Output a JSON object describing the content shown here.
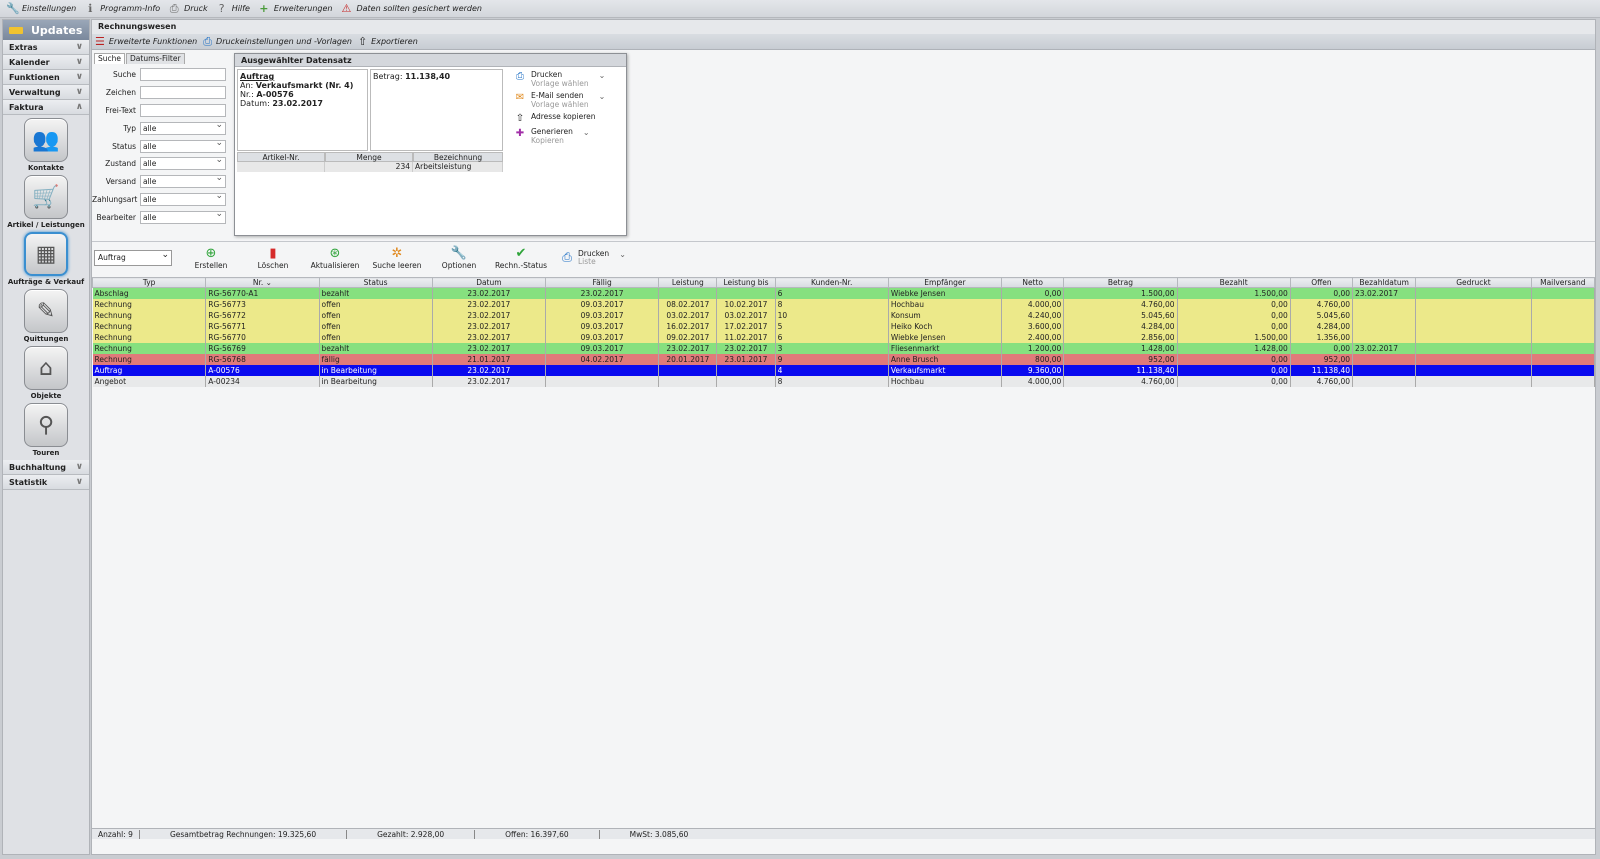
{
  "topbar": [
    {
      "label": "Einstellungen",
      "icon": "wrench-icon"
    },
    {
      "label": "Programm-Info",
      "icon": "info-icon"
    },
    {
      "label": "Druck",
      "icon": "printer-icon"
    },
    {
      "label": "Hilfe",
      "icon": "help-icon"
    },
    {
      "label": "Erweiterungen",
      "icon": "plus-icon"
    },
    {
      "label": "Daten sollten gesichert werden",
      "icon": "warning-icon"
    }
  ],
  "sidebar": {
    "title": "Updates",
    "sections_top": [
      "Extras",
      "Kalender",
      "Funktionen",
      "Verwaltung",
      "Faktura"
    ],
    "tiles": [
      {
        "label": "Kontakte",
        "icon": "contacts-icon"
      },
      {
        "label": "Artikel / Leistungen",
        "icon": "cart-icon"
      },
      {
        "label": "Aufträge & Verkauf",
        "icon": "calculator-icon"
      },
      {
        "label": "Quittungen",
        "icon": "pen-icon"
      },
      {
        "label": "Objekte",
        "icon": "house-icon"
      },
      {
        "label": "Touren",
        "icon": "map-pin-icon"
      }
    ],
    "sections_bottom": [
      "Buchhaltung",
      "Statistik"
    ]
  },
  "main": {
    "title": "Rechnungswesen",
    "toolbar": [
      "Erweiterte Funktionen",
      "Druckeinstellungen und -Vorlagen",
      "Exportieren"
    ]
  },
  "search": {
    "tabs": [
      "Suche",
      "Datums-Filter"
    ],
    "fields": [
      {
        "label": "Suche",
        "value": ""
      },
      {
        "label": "Zeichen",
        "value": ""
      },
      {
        "label": "Frei-Text",
        "value": ""
      }
    ],
    "selects": [
      {
        "label": "Typ",
        "value": "alle"
      },
      {
        "label": "Status",
        "value": "alle"
      },
      {
        "label": "Zustand",
        "value": "alle"
      },
      {
        "label": "Versand",
        "value": "alle"
      },
      {
        "label": "Zahlungsart",
        "value": "alle"
      },
      {
        "label": "Bearbeiter",
        "value": "alle"
      }
    ]
  },
  "detail": {
    "title": "Ausgewählter Datensatz",
    "doc_type": "Auftrag",
    "an_label": "An:",
    "an_value": "Verkaufsmarkt (Nr. 4)",
    "nr_label": "Nr.:",
    "nr_value": "A-00576",
    "datum_label": "Datum:",
    "datum_value": "23.02.2017",
    "betrag_label": "Betrag:",
    "betrag_value": "11.138,40",
    "table_headers": [
      "Artikel-Nr.",
      "Menge",
      "Bezeichnung"
    ],
    "table_rows": [
      [
        "",
        "234",
        "Arbeitsleistung"
      ]
    ],
    "actions": [
      {
        "label": "Drucken",
        "sub": "Vorlage wählen",
        "icon": "printer-icon",
        "dropdown": true
      },
      {
        "label": "E-Mail senden",
        "sub": "Vorlage wählen",
        "icon": "mail-icon",
        "dropdown": true
      },
      {
        "label": "Adresse kopieren",
        "sub": "",
        "icon": "upload-icon",
        "dropdown": false
      },
      {
        "label": "Generieren",
        "sub": "Kopieren",
        "icon": "puzzle-icon",
        "dropdown": true
      }
    ]
  },
  "listbar": {
    "combo": "Auftrag",
    "buttons": [
      {
        "label": "Erstellen",
        "icon": "add-icon",
        "color": "#2fa43a"
      },
      {
        "label": "Löschen",
        "icon": "trash-icon",
        "color": "#d62b2b"
      },
      {
        "label": "Aktualisieren",
        "icon": "refresh-icon",
        "color": "#2fa43a"
      },
      {
        "label": "Suche leeren",
        "icon": "clear-search-icon",
        "color": "#e0891f"
      },
      {
        "label": "Optionen",
        "icon": "wrench-icon",
        "color": "#666666"
      },
      {
        "label": "Rechn.-Status",
        "icon": "check-icon",
        "color": "#2fa43a"
      }
    ],
    "print": {
      "label": "Drucken",
      "sub": "Liste"
    }
  },
  "grid": {
    "headers": [
      "Typ",
      "Nr. ⌄",
      "Status",
      "Datum",
      "Fällig",
      "Leistung",
      "Leistung bis",
      "Kunden-Nr.",
      "Empfänger",
      "Netto",
      "Betrag",
      "Bezahlt",
      "Offen",
      "Bezahldatum",
      "Gedruckt",
      "Mailversand"
    ],
    "rows": [
      {
        "style": "green",
        "cells": [
          "Abschlag",
          "RG-56770-A1",
          "bezahlt",
          "23.02.2017",
          "23.02.2017",
          "",
          "",
          "6",
          "Wiebke Jensen",
          "0,00",
          "1.500,00",
          "1.500,00",
          "0,00",
          "23.02.2017",
          "",
          ""
        ]
      },
      {
        "style": "yellow",
        "cells": [
          "Rechnung",
          "RG-56773",
          "offen",
          "23.02.2017",
          "09.03.2017",
          "08.02.2017",
          "10.02.2017",
          "8",
          "Hochbau",
          "4.000,00",
          "4.760,00",
          "0,00",
          "4.760,00",
          "",
          "",
          ""
        ]
      },
      {
        "style": "yellow",
        "cells": [
          "Rechnung",
          "RG-56772",
          "offen",
          "23.02.2017",
          "09.03.2017",
          "03.02.2017",
          "03.02.2017",
          "10",
          "Konsum",
          "4.240,00",
          "5.045,60",
          "0,00",
          "5.045,60",
          "",
          "",
          ""
        ]
      },
      {
        "style": "yellow",
        "cells": [
          "Rechnung",
          "RG-56771",
          "offen",
          "23.02.2017",
          "09.03.2017",
          "16.02.2017",
          "17.02.2017",
          "5",
          "Heiko Koch",
          "3.600,00",
          "4.284,00",
          "0,00",
          "4.284,00",
          "",
          "",
          ""
        ]
      },
      {
        "style": "yellow",
        "cells": [
          "Rechnung",
          "RG-56770",
          "offen",
          "23.02.2017",
          "09.03.2017",
          "09.02.2017",
          "11.02.2017",
          "6",
          "Wiebke Jensen",
          "2.400,00",
          "2.856,00",
          "1.500,00",
          "1.356,00",
          "",
          "",
          ""
        ]
      },
      {
        "style": "green",
        "cells": [
          "Rechnung",
          "RG-56769",
          "bezahlt",
          "23.02.2017",
          "09.03.2017",
          "23.02.2017",
          "23.02.2017",
          "3",
          "Fliesenmarkt",
          "1.200,00",
          "1.428,00",
          "1.428,00",
          "0,00",
          "23.02.2017",
          "",
          ""
        ]
      },
      {
        "style": "red",
        "cells": [
          "Rechnung",
          "RG-56768",
          "fällig",
          "21.01.2017",
          "04.02.2017",
          "20.01.2017",
          "23.01.2017",
          "9",
          "Anne Brusch",
          "800,00",
          "952,00",
          "0,00",
          "952,00",
          "",
          "",
          ""
        ]
      },
      {
        "style": "blue",
        "cells": [
          "Auftrag",
          "A-00576",
          "in Bearbeitung",
          "23.02.2017",
          "",
          "",
          "",
          "4",
          "Verkaufsmarkt",
          "9.360,00",
          "11.138,40",
          "0,00",
          "11.138,40",
          "",
          "",
          ""
        ]
      },
      {
        "style": "gray",
        "cells": [
          "Angebot",
          "A-00234",
          "in Bearbeitung",
          "23.02.2017",
          "",
          "",
          "",
          "8",
          "Hochbau",
          "4.000,00",
          "4.760,00",
          "0,00",
          "4.760,00",
          "",
          "",
          ""
        ]
      }
    ]
  },
  "status": {
    "anzahl": "Anzahl: 9",
    "gesamt": "Gesamtbetrag Rechnungen: 19.325,60",
    "gezahlt": "Gezahlt: 2.928,00",
    "offen": "Offen: 16.397,60",
    "mwst": "MwSt: 3.085,60"
  }
}
